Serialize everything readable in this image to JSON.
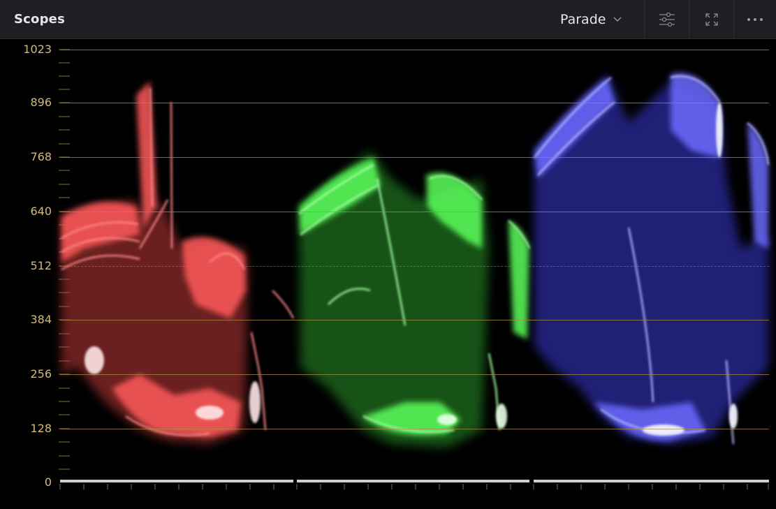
{
  "panel": {
    "title": "Scopes",
    "mode_label": "Parade"
  },
  "toolbar": {
    "settings_icon": "sliders-icon",
    "expand_icon": "expand-icon",
    "more_icon": "more-icon"
  },
  "scope": {
    "y_axis_labels": [
      "1023",
      "896",
      "768",
      "640",
      "512",
      "384",
      "256",
      "128",
      "0"
    ],
    "channels": [
      {
        "name": "red",
        "color": "#ff6a6a"
      },
      {
        "name": "green",
        "color": "#6cff6c"
      },
      {
        "name": "blue",
        "color": "#6f6fff"
      }
    ],
    "grid_color": "#aa8c46",
    "label_color": "#d6b97a"
  }
}
